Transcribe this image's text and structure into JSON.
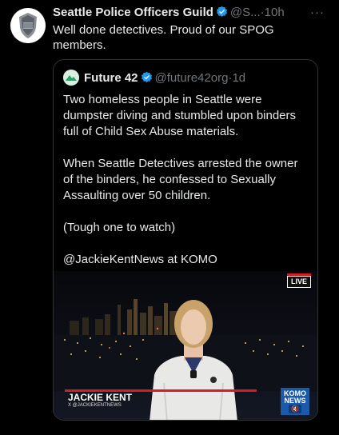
{
  "post": {
    "author_name": "Seattle Police Officers Guild",
    "handle": "@S...",
    "separator": "·",
    "time": "10h",
    "more_label": "···",
    "text": "Well done detectives.  Proud of our SPOG members."
  },
  "quoted": {
    "author_name": "Future 42",
    "handle": "@future42org",
    "separator": "·",
    "time": "1d",
    "paragraphs": [
      "Two homeless people in Seattle were dumpster diving and stumbled upon binders full of Child Sex Abuse materials.",
      "When Seattle Detectives arrested the owner of the binders, he confessed to Sexually Assaulting over 50 children.",
      "(Tough one to watch)",
      "@JackieKentNews at KOMO"
    ],
    "video": {
      "live_label": "LIVE",
      "reporter_name": "JACKIE KENT",
      "reporter_handle": "X @JACKIEKENTNEWS",
      "station_logo": "KOMO NEWS",
      "volume_icon": "speaker-muted-icon"
    }
  },
  "colors": {
    "background": "#000000",
    "text": "#e7e9ea",
    "muted": "#71767b",
    "verified": "#1d9bf0",
    "border": "#2f3336",
    "news_red": "#d71d1d",
    "komo_blue": "#1b5aa8"
  }
}
